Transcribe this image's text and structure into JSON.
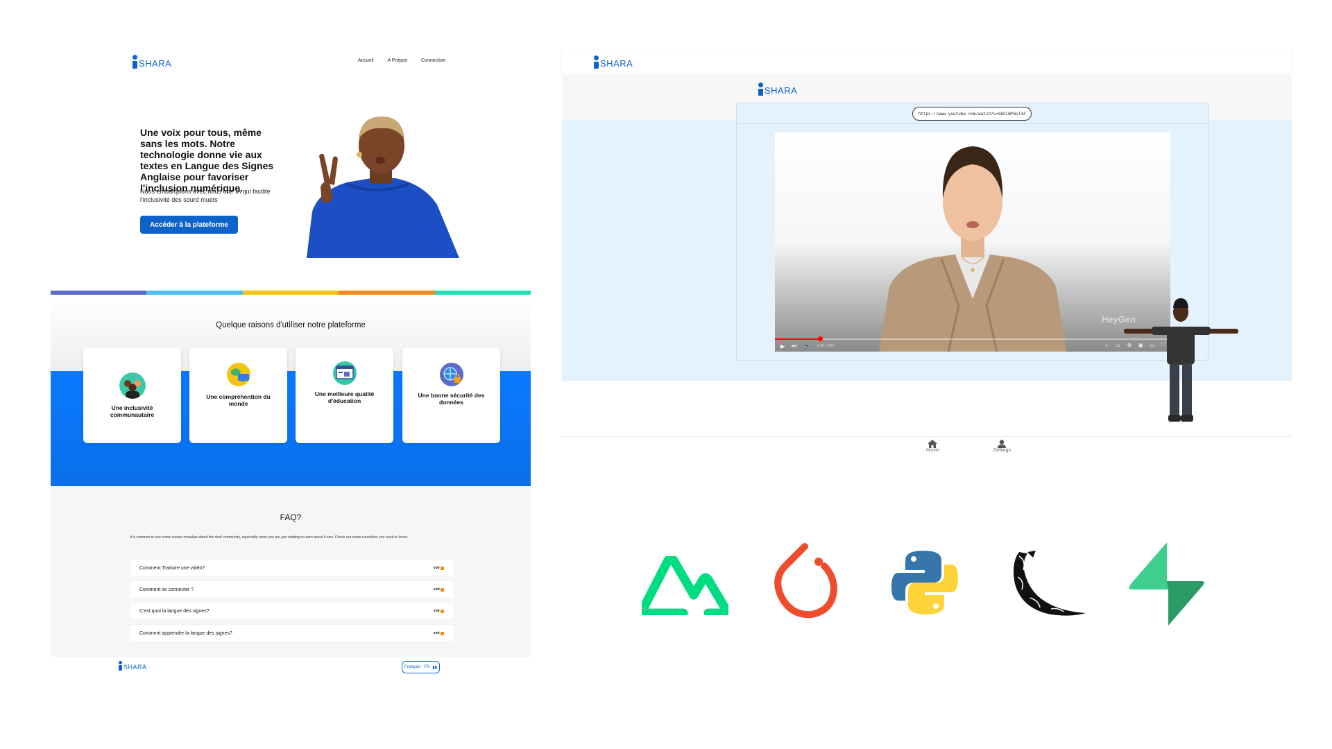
{
  "landing": {
    "logo_text": "SHARA",
    "nav": [
      "Accueil",
      "A Propos",
      "Connection"
    ],
    "hero_title": "Une voix pour tous, même sans les mots. Notre technologie donne vie aux textes en Langue des Signes Anglaise pour favoriser l'inclusion numérique.",
    "hero_subtitle": "Nous embarquons avec nous une IA qui facilite l'inclusivité des sourd muets",
    "cta_label": "Accéder à la plateforme",
    "stripe_colors": [
      "#5b6bc9",
      "#4ec0f2",
      "#f5c313",
      "#f28a1e",
      "#1fe0b4"
    ],
    "reasons_title": "Quelque raisons d'utiliser notre plateforme",
    "reasons": [
      {
        "label": "Une inclusivité communautaire",
        "icon": "community-icon"
      },
      {
        "label": "Une compréhention du monde",
        "icon": "world-understanding-icon"
      },
      {
        "label": "Une meilleure qualité d'éducation",
        "icon": "education-icon"
      },
      {
        "label": "Une bonne sécurité des données",
        "icon": "data-security-icon"
      }
    ],
    "faq_title": "FAQ?",
    "faq_intro": "It is common to see some classic mistakes about the deaf community, especially when you are just starting to learn about it now. Check out some curiosities you need to know.",
    "faq_items": [
      "Comment Traduire une vidéo?",
      "Comment se connecter ?",
      "C'est quoi la langue des signes?",
      "Comment apprendre la langue des signes?"
    ],
    "faq_more_label": "voir",
    "footer_logo": "SHARA",
    "language_button": "Français - FR"
  },
  "app": {
    "logo_text": "SHARA",
    "inner_logo_text": "SHARA",
    "url_value": "https://www.youtube.com/watch?v=9kCLWYNsT44",
    "video_watermark": "HeyGen",
    "video_time": "0:00 / 0:00",
    "bottom_nav": [
      {
        "label": "Home",
        "icon": "home-icon"
      },
      {
        "label": "Settings",
        "icon": "user-icon"
      }
    ]
  },
  "tech_logos": [
    "nuxt-logo",
    "pytorch-logo",
    "python-logo",
    "flask-logo",
    "supabase-logo"
  ],
  "colors": {
    "brand_blue": "#0d63c7",
    "cta_blue": "#0d63c7",
    "reasons_blue": "#0a79ff",
    "app_panel": "#e3f2fd",
    "nuxt_green": "#00dc82",
    "pytorch_orange": "#ee4c2c",
    "supabase_green": "#3ecf8e"
  }
}
